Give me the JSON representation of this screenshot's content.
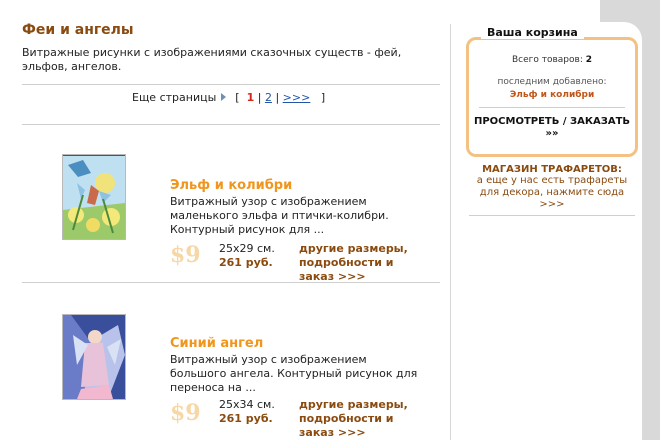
{
  "page": {
    "title": "Феи и ангелы",
    "description": "Витражные рисунки с изображениями сказочных существ - фей, эльфов, ангелов."
  },
  "pager": {
    "label": "Еще страницы",
    "open": "[",
    "current": "1",
    "sep1": "|",
    "page2": "2",
    "sep2": "|",
    "next": ">>>",
    "close": "]"
  },
  "products": [
    {
      "title": "Эльф и колибри",
      "text": "Витражный узор с изображением маленького эльфа и птички-колибри. Контурный рисунок для ...",
      "price": "$9",
      "size": "25x29 см.",
      "rub": "261 руб.",
      "more": "другие размеры, подробности и заказ >>>"
    },
    {
      "title": "Синий ангел",
      "text": "Витражный узор с изображением большого ангела. Контурный рисунок для переноса на ...",
      "price": "$9",
      "size": "25x34 см.",
      "rub": "261 руб.",
      "more": "другие размеры, подробности и заказ >>>"
    }
  ],
  "cart": {
    "title": "Ваша корзина",
    "count_label": "Всего товаров:",
    "count": "2",
    "last_label": "последним добавлено:",
    "last_item": "Эльф и колибри",
    "button": "ПРОСМОТРЕТЬ / ЗАКАЗАТЬ",
    "button_arrows": "»»"
  },
  "shop": {
    "title": "МАГАЗИН ТРАФАРЕТОВ:",
    "text": "а еще у нас есть трафареты для декора, нажмите сюда >>>"
  },
  "colors": {
    "heading": "#8a4b10",
    "product_title": "#f0961c",
    "price": "#f7d7a5",
    "cart_border": "#f3c283"
  }
}
